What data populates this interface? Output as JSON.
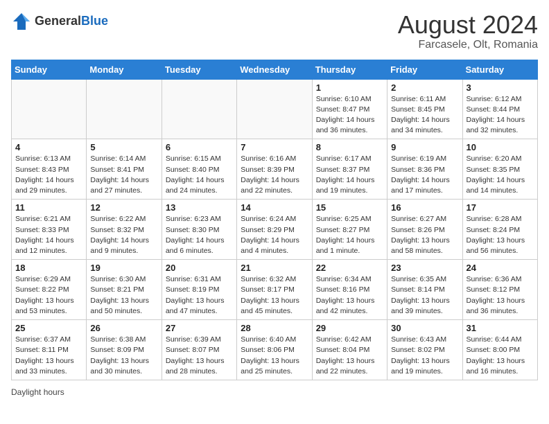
{
  "header": {
    "logo_general": "General",
    "logo_blue": "Blue",
    "month_title": "August 2024",
    "location": "Farcasele, Olt, Romania"
  },
  "weekdays": [
    "Sunday",
    "Monday",
    "Tuesday",
    "Wednesday",
    "Thursday",
    "Friday",
    "Saturday"
  ],
  "weeks": [
    [
      {
        "day": "",
        "info": ""
      },
      {
        "day": "",
        "info": ""
      },
      {
        "day": "",
        "info": ""
      },
      {
        "day": "",
        "info": ""
      },
      {
        "day": "1",
        "info": "Sunrise: 6:10 AM\nSunset: 8:47 PM\nDaylight: 14 hours and 36 minutes."
      },
      {
        "day": "2",
        "info": "Sunrise: 6:11 AM\nSunset: 8:45 PM\nDaylight: 14 hours and 34 minutes."
      },
      {
        "day": "3",
        "info": "Sunrise: 6:12 AM\nSunset: 8:44 PM\nDaylight: 14 hours and 32 minutes."
      }
    ],
    [
      {
        "day": "4",
        "info": "Sunrise: 6:13 AM\nSunset: 8:43 PM\nDaylight: 14 hours and 29 minutes."
      },
      {
        "day": "5",
        "info": "Sunrise: 6:14 AM\nSunset: 8:41 PM\nDaylight: 14 hours and 27 minutes."
      },
      {
        "day": "6",
        "info": "Sunrise: 6:15 AM\nSunset: 8:40 PM\nDaylight: 14 hours and 24 minutes."
      },
      {
        "day": "7",
        "info": "Sunrise: 6:16 AM\nSunset: 8:39 PM\nDaylight: 14 hours and 22 minutes."
      },
      {
        "day": "8",
        "info": "Sunrise: 6:17 AM\nSunset: 8:37 PM\nDaylight: 14 hours and 19 minutes."
      },
      {
        "day": "9",
        "info": "Sunrise: 6:19 AM\nSunset: 8:36 PM\nDaylight: 14 hours and 17 minutes."
      },
      {
        "day": "10",
        "info": "Sunrise: 6:20 AM\nSunset: 8:35 PM\nDaylight: 14 hours and 14 minutes."
      }
    ],
    [
      {
        "day": "11",
        "info": "Sunrise: 6:21 AM\nSunset: 8:33 PM\nDaylight: 14 hours and 12 minutes."
      },
      {
        "day": "12",
        "info": "Sunrise: 6:22 AM\nSunset: 8:32 PM\nDaylight: 14 hours and 9 minutes."
      },
      {
        "day": "13",
        "info": "Sunrise: 6:23 AM\nSunset: 8:30 PM\nDaylight: 14 hours and 6 minutes."
      },
      {
        "day": "14",
        "info": "Sunrise: 6:24 AM\nSunset: 8:29 PM\nDaylight: 14 hours and 4 minutes."
      },
      {
        "day": "15",
        "info": "Sunrise: 6:25 AM\nSunset: 8:27 PM\nDaylight: 14 hours and 1 minute."
      },
      {
        "day": "16",
        "info": "Sunrise: 6:27 AM\nSunset: 8:26 PM\nDaylight: 13 hours and 58 minutes."
      },
      {
        "day": "17",
        "info": "Sunrise: 6:28 AM\nSunset: 8:24 PM\nDaylight: 13 hours and 56 minutes."
      }
    ],
    [
      {
        "day": "18",
        "info": "Sunrise: 6:29 AM\nSunset: 8:22 PM\nDaylight: 13 hours and 53 minutes."
      },
      {
        "day": "19",
        "info": "Sunrise: 6:30 AM\nSunset: 8:21 PM\nDaylight: 13 hours and 50 minutes."
      },
      {
        "day": "20",
        "info": "Sunrise: 6:31 AM\nSunset: 8:19 PM\nDaylight: 13 hours and 47 minutes."
      },
      {
        "day": "21",
        "info": "Sunrise: 6:32 AM\nSunset: 8:17 PM\nDaylight: 13 hours and 45 minutes."
      },
      {
        "day": "22",
        "info": "Sunrise: 6:34 AM\nSunset: 8:16 PM\nDaylight: 13 hours and 42 minutes."
      },
      {
        "day": "23",
        "info": "Sunrise: 6:35 AM\nSunset: 8:14 PM\nDaylight: 13 hours and 39 minutes."
      },
      {
        "day": "24",
        "info": "Sunrise: 6:36 AM\nSunset: 8:12 PM\nDaylight: 13 hours and 36 minutes."
      }
    ],
    [
      {
        "day": "25",
        "info": "Sunrise: 6:37 AM\nSunset: 8:11 PM\nDaylight: 13 hours and 33 minutes."
      },
      {
        "day": "26",
        "info": "Sunrise: 6:38 AM\nSunset: 8:09 PM\nDaylight: 13 hours and 30 minutes."
      },
      {
        "day": "27",
        "info": "Sunrise: 6:39 AM\nSunset: 8:07 PM\nDaylight: 13 hours and 28 minutes."
      },
      {
        "day": "28",
        "info": "Sunrise: 6:40 AM\nSunset: 8:06 PM\nDaylight: 13 hours and 25 minutes."
      },
      {
        "day": "29",
        "info": "Sunrise: 6:42 AM\nSunset: 8:04 PM\nDaylight: 13 hours and 22 minutes."
      },
      {
        "day": "30",
        "info": "Sunrise: 6:43 AM\nSunset: 8:02 PM\nDaylight: 13 hours and 19 minutes."
      },
      {
        "day": "31",
        "info": "Sunrise: 6:44 AM\nSunset: 8:00 PM\nDaylight: 13 hours and 16 minutes."
      }
    ]
  ],
  "footer": {
    "daylight_note": "Daylight hours"
  }
}
